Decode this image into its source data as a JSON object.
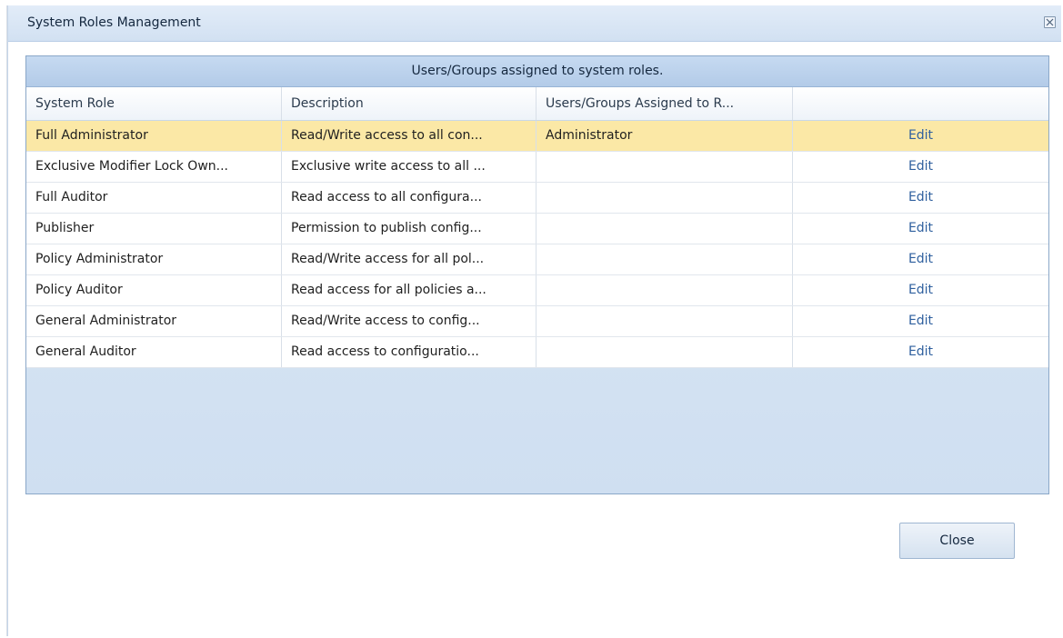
{
  "dialog": {
    "title": "System Roles Management",
    "close_icon": "close-icon"
  },
  "grid": {
    "caption": "Users/Groups assigned to system roles.",
    "columns": [
      "System Role",
      "Description",
      "Users/Groups Assigned to R...",
      ""
    ],
    "rows": [
      {
        "role": "Full Administrator",
        "description": "Read/Write access to all con...",
        "assigned": "Administrator",
        "action": "Edit",
        "selected": true
      },
      {
        "role": "Exclusive Modifier Lock Own...",
        "description": "Exclusive write access to all ...",
        "assigned": "",
        "action": "Edit",
        "selected": false
      },
      {
        "role": "Full Auditor",
        "description": "Read access to all configura...",
        "assigned": "",
        "action": "Edit",
        "selected": false
      },
      {
        "role": "Publisher",
        "description": "Permission to publish config...",
        "assigned": "",
        "action": "Edit",
        "selected": false
      },
      {
        "role": "Policy Administrator",
        "description": "Read/Write access for all pol...",
        "assigned": "",
        "action": "Edit",
        "selected": false
      },
      {
        "role": "Policy Auditor",
        "description": "Read access for all policies a...",
        "assigned": "",
        "action": "Edit",
        "selected": false
      },
      {
        "role": "General Administrator",
        "description": "Read/Write access to config...",
        "assigned": "",
        "action": "Edit",
        "selected": false
      },
      {
        "role": "General Auditor",
        "description": "Read access to configuratio...",
        "assigned": "",
        "action": "Edit",
        "selected": false
      }
    ]
  },
  "footer": {
    "close_label": "Close"
  },
  "colors": {
    "selected_row": "#fbe8a6",
    "link": "#2e5f9e",
    "header_blue": "#c6daf1"
  }
}
